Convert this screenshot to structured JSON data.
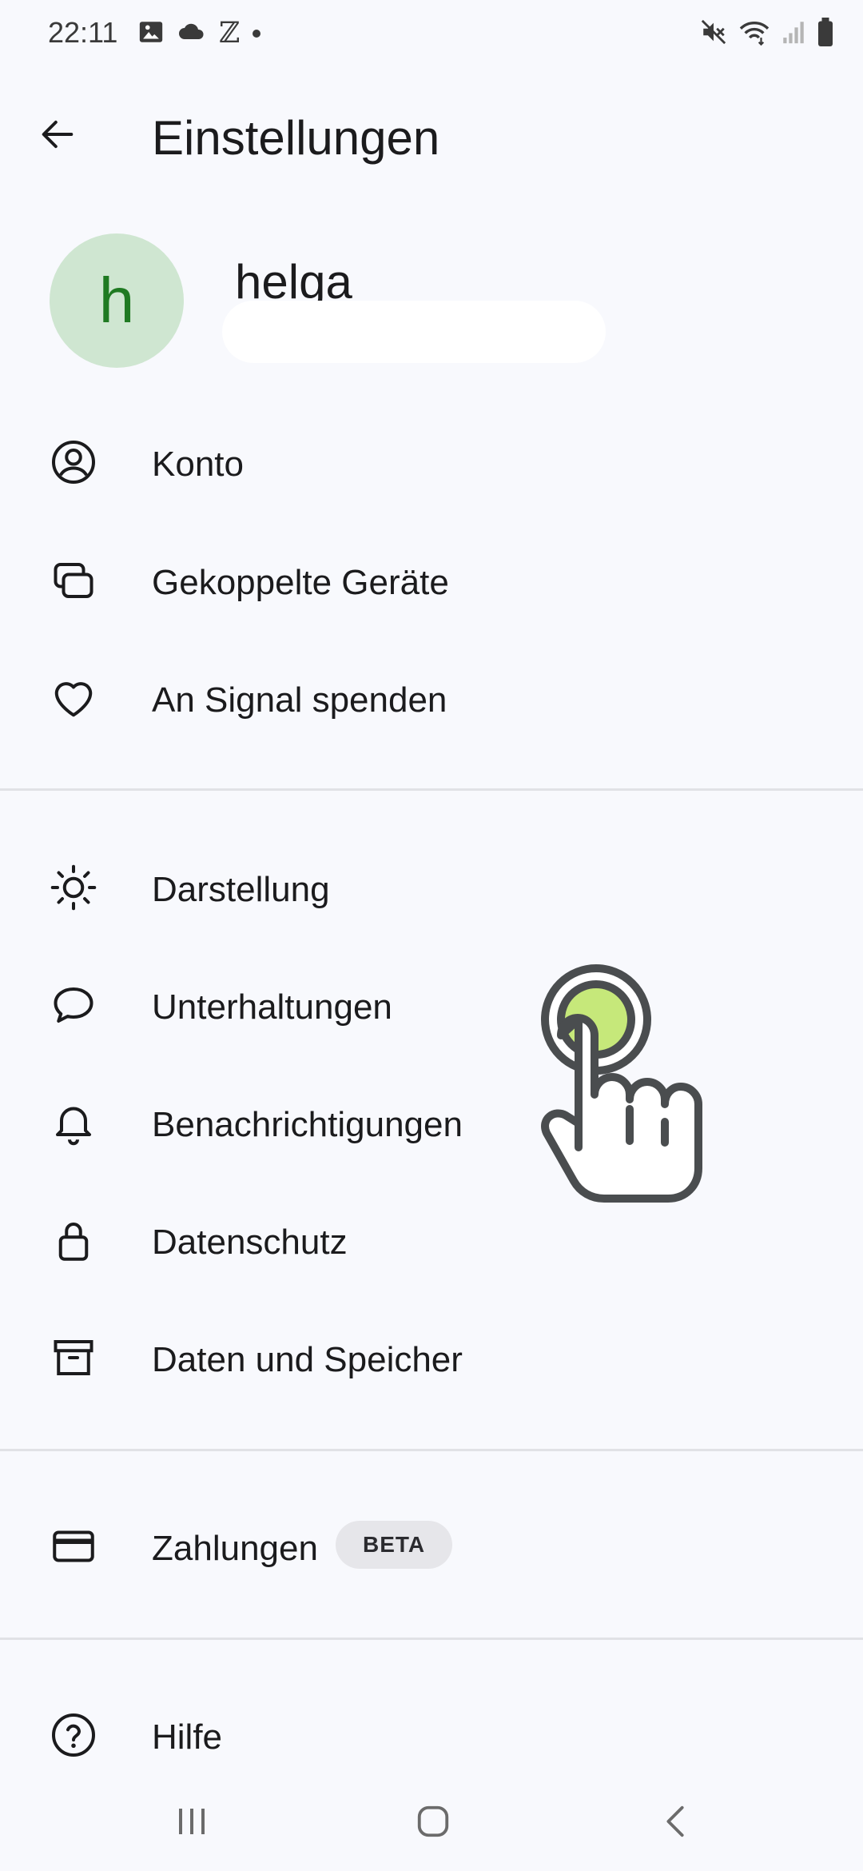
{
  "status_bar": {
    "time": "22:11",
    "left_icons": [
      "image-icon",
      "cloud-icon",
      "z-icon",
      "dot"
    ],
    "z_glyph": "ℤ",
    "right_icons": [
      "mute-icon",
      "wifi-icon",
      "signal-icon",
      "battery-icon"
    ]
  },
  "header": {
    "title": "Einstellungen"
  },
  "profile": {
    "initial": "h",
    "name": "helga",
    "avatar_bg": "#cfe6d1",
    "avatar_fg": "#1f7a22"
  },
  "menu": {
    "account": "Konto",
    "linked_devices": "Gekoppelte Geräte",
    "donate": "An Signal spenden",
    "appearance": "Darstellung",
    "chats": "Unterhaltungen",
    "notifications": "Benachrichtigungen",
    "privacy": "Datenschutz",
    "data_storage": "Daten und Speicher",
    "payments": "Zahlungen",
    "payments_badge": "BETA",
    "help": "Hilfe"
  },
  "colors": {
    "background": "#f8f9fd",
    "divider": "#e1e2e6",
    "tap_indicator": "#c6e87a"
  }
}
